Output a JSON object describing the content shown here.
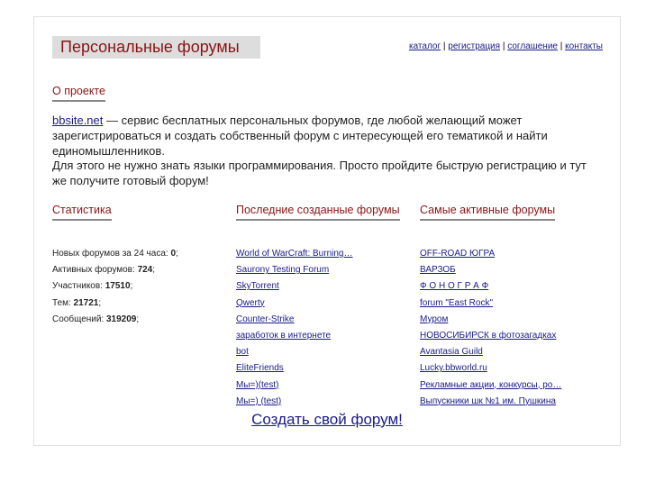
{
  "title": "Персональные форумы",
  "nav": [
    "каталог",
    "регистрация",
    "соглашение",
    "контакты"
  ],
  "about": {
    "heading": "О проекте",
    "site": "bbsite.net",
    "text1": " — сервис бесплатных персональных форумов, где любой желающий может зарегистрироваться и создать собственный форум с интересующей его тематикой и найти единомышленников.",
    "text2": "Для этого не нужно знать языки программирования. Просто пройдите быструю регистрацию и тут же получите готовый форум!"
  },
  "stats": {
    "heading": "Статистика",
    "rows": [
      {
        "label": "Новых форумов за 24 часа: ",
        "value": "0"
      },
      {
        "label": "Активных форумов: ",
        "value": "724"
      },
      {
        "label": "Участников: ",
        "value": "17510"
      },
      {
        "label": "Тем: ",
        "value": "21721"
      },
      {
        "label": "Сообщений: ",
        "value": "319209"
      }
    ]
  },
  "latest": {
    "heading": "Последние созданные форумы",
    "items": [
      "World of WarCraft: Burning…",
      "Saurony Testing Forum",
      "SkyTorrent",
      "Qwerty",
      "Counter-Strike",
      "заработок в интернете",
      "bot",
      "EliteFriends",
      "Мы=)(test)",
      "Мы=) (test)"
    ]
  },
  "active": {
    "heading": "Самые активные форумы",
    "items": [
      "OFF-ROAD ЮГРА",
      "ВАРЗОБ",
      "Ф О Н О Г Р А Ф",
      "forum \"East Rock\"",
      "Муром",
      "НОВОСИБИРСК в фотозагадках",
      "Avantasia Guild",
      "Lucky.bbworld.ru",
      "Рекламные акции, конкурсы, ро…",
      "Выпускники шк №1 им. Пушкина"
    ]
  },
  "create": "Создать свой форум!"
}
